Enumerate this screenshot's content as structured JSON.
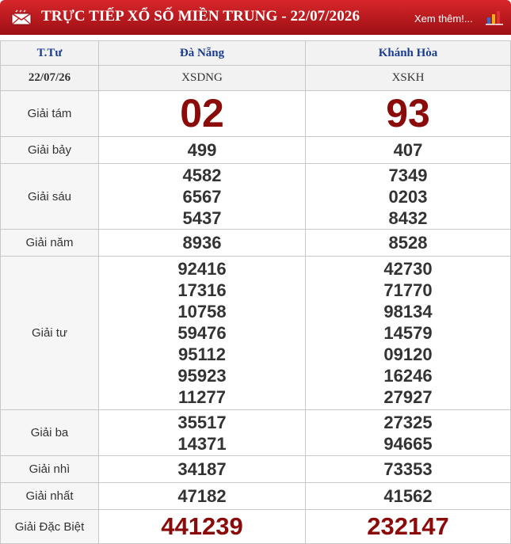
{
  "header": {
    "title": "TRỰC TIẾP XỔ SỐ MIỀN TRUNG - 22/07/2026",
    "more_link": "Xem thêm!...",
    "accent_color": "#c41a1f"
  },
  "table": {
    "col_label_header": "T.Tư",
    "provinces": [
      {
        "name": "Đà Nẵng",
        "code": "XSDNG"
      },
      {
        "name": "Khánh Hòa",
        "code": "XSKH"
      }
    ],
    "date": "22/07/26",
    "prizes": [
      {
        "label": "Giải tám",
        "a": [
          "02"
        ],
        "b": [
          "93"
        ]
      },
      {
        "label": "Giải bảy",
        "a": [
          "499"
        ],
        "b": [
          "407"
        ]
      },
      {
        "label": "Giải sáu",
        "a": [
          "4582",
          "6567",
          "5437"
        ],
        "b": [
          "7349",
          "0203",
          "8432"
        ]
      },
      {
        "label": "Giải năm",
        "a": [
          "8936"
        ],
        "b": [
          "8528"
        ]
      },
      {
        "label": "Giải tư",
        "a": [
          "92416",
          "17316",
          "10758",
          "59476",
          "95112",
          "95923",
          "11277"
        ],
        "b": [
          "42730",
          "71770",
          "98134",
          "14579",
          "09120",
          "16246",
          "27927"
        ]
      },
      {
        "label": "Giải ba",
        "a": [
          "35517",
          "14371"
        ],
        "b": [
          "27325",
          "94665"
        ]
      },
      {
        "label": "Giải nhì",
        "a": [
          "34187"
        ],
        "b": [
          "73353"
        ]
      },
      {
        "label": "Giải nhất",
        "a": [
          "47182"
        ],
        "b": [
          "41562"
        ]
      },
      {
        "label": "Giải Đặc Biệt",
        "a": [
          "441239"
        ],
        "b": [
          "232147"
        ]
      }
    ],
    "highlight_color": "#8b0a0a"
  }
}
